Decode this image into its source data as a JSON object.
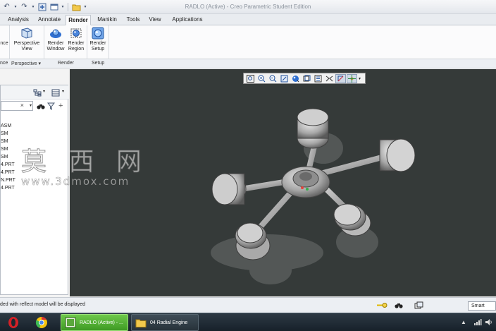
{
  "window": {
    "title": "RADLO (Active) - Creo Parametric Student Edition"
  },
  "quick_access": [
    "undo-icon",
    "redo-icon",
    "regenerate-icon",
    "windows-icon",
    "folder-icon"
  ],
  "tabs": [
    {
      "label": "Analysis",
      "active": false
    },
    {
      "label": "Annotate",
      "active": false
    },
    {
      "label": "Render",
      "active": true
    },
    {
      "label": "Manikin",
      "active": false
    },
    {
      "label": "Tools",
      "active": false
    },
    {
      "label": "View",
      "active": false
    },
    {
      "label": "Applications",
      "active": false
    }
  ],
  "ribbon": {
    "buttons": [
      {
        "line1": "nce",
        "line2": "",
        "icon": "appearance-icon"
      },
      {
        "line1": "Perspective",
        "line2": "View",
        "icon": "perspective-view-icon"
      },
      {
        "line1": "Render",
        "line2": "Window",
        "icon": "render-window-icon"
      },
      {
        "line1": "Render",
        "line2": "Region",
        "icon": "render-region-icon"
      },
      {
        "line1": "Render",
        "line2": "Setup",
        "icon": "render-setup-icon"
      }
    ],
    "groups": [
      {
        "label": "nce"
      },
      {
        "label": "Perspective ▾"
      },
      {
        "label": "Render"
      },
      {
        "label": "Setup"
      }
    ]
  },
  "left_panel": {
    "search_value": "",
    "search_clear": "×",
    "tree_items": [
      "ASM",
      "SM",
      "SM",
      "SM",
      "SM",
      "4.PRT",
      "4.PRT",
      "N.PRT",
      "4.PRT"
    ]
  },
  "viewport_toolbar": [
    "zoom-fit-icon",
    "zoom-in-icon",
    "zoom-out-icon",
    "repaint-icon",
    "display-style-icon",
    "saved-views-icon",
    "view-manager-icon",
    "perspective-icon",
    "datum-display-icon",
    "spin-center-icon"
  ],
  "watermark": {
    "chinese": "莫 西 网",
    "url": "www.3dmox.com"
  },
  "statusbar": {
    "message": "ded with reflect model will be displayed",
    "filter": "Smart"
  },
  "taskbar": {
    "apps": [
      {
        "label": "",
        "icon": "opera-icon"
      },
      {
        "label": "",
        "icon": "chrome-icon"
      },
      {
        "label": "RADLO (Active) - ...",
        "icon": "creo-icon"
      },
      {
        "label": "04 Radial Engine",
        "icon": "folder-icon"
      }
    ]
  },
  "colors": {
    "viewport_bg": "#353a39",
    "active_app": "#4fae2e",
    "taskbar": "#1d2830"
  }
}
